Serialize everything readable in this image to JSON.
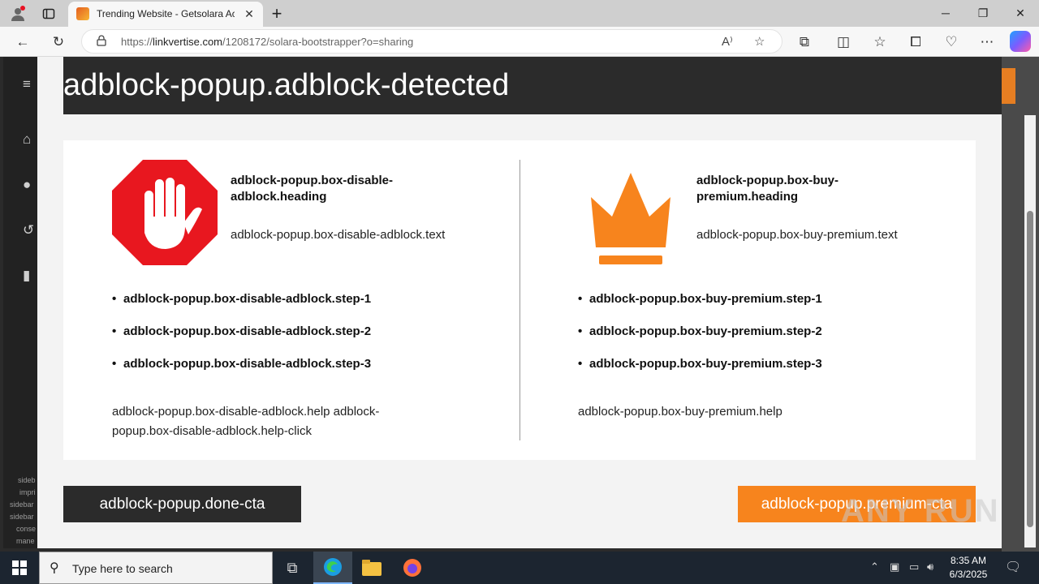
{
  "browser": {
    "tab": {
      "title": "Trending Website - Getsolara Acc"
    },
    "address": {
      "scheme": "https://",
      "host": "linkvertise.com",
      "path": "/1208172/solara-bootstrapper?o=sharing"
    }
  },
  "page": {
    "sidebar_texts": [
      "sideb",
      "impri",
      "sidebar",
      "sidebar",
      "conse",
      "mane"
    ]
  },
  "modal": {
    "title": "adblock-popup.adblock-detected",
    "left": {
      "heading": "adblock-popup.box-disable-adblock.heading",
      "text": "adblock-popup.box-disable-adblock.text",
      "steps": [
        "adblock-popup.box-disable-adblock.step-1",
        "adblock-popup.box-disable-adblock.step-2",
        "adblock-popup.box-disable-adblock.step-3"
      ],
      "help": "adblock-popup.box-disable-adblock.help adblock-popup.box-disable-adblock.help-click"
    },
    "right": {
      "heading": "adblock-popup.box-buy-premium.heading",
      "text": "adblock-popup.box-buy-premium.text",
      "steps": [
        "adblock-popup.box-buy-premium.step-1",
        "adblock-popup.box-buy-premium.step-2",
        "adblock-popup.box-buy-premium.step-3"
      ],
      "help": "adblock-popup.box-buy-premium.help"
    },
    "done_cta": "adblock-popup.done-cta",
    "premium_cta": "adblock-popup.premium-cta"
  },
  "watermark": "ANY RUN",
  "taskbar": {
    "search_placeholder": "Type here to search",
    "time": "8:35 AM",
    "date": "6/3/2025"
  },
  "colors": {
    "accent_orange": "#f7841d",
    "stop_red": "#e8171f",
    "dark": "#2b2b2b"
  }
}
